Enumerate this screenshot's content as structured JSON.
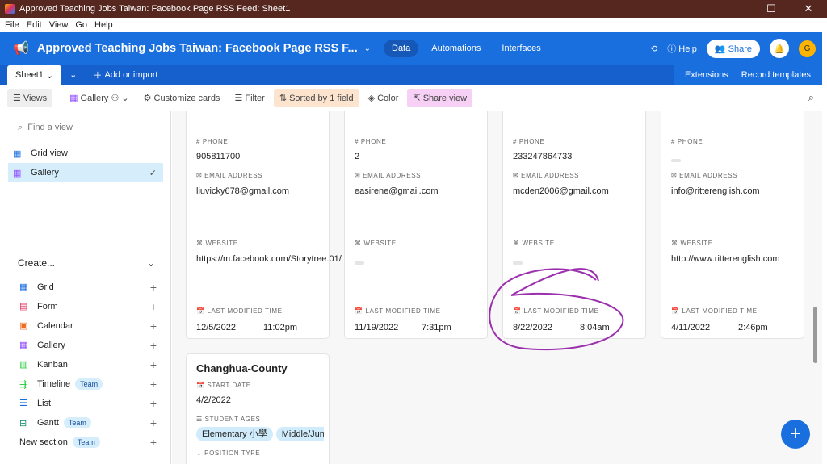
{
  "window": {
    "title": "Approved Teaching Jobs Taiwan: Facebook Page RSS Feed: Sheet1",
    "minimize": "—",
    "maximize": "☐",
    "close": "✕"
  },
  "menu": [
    "File",
    "Edit",
    "View",
    "Go",
    "Help"
  ],
  "header": {
    "base_title": "Approved Teaching Jobs Taiwan: Facebook Page RSS F...",
    "nav": [
      "Data",
      "Automations",
      "Interfaces"
    ],
    "help": "Help",
    "share": "Share",
    "avatar": "G"
  },
  "tabs": {
    "active": "Sheet1",
    "add": "Add or import",
    "extensions": "Extensions",
    "record_templates": "Record templates"
  },
  "toolbar": {
    "views": "Views",
    "gallery": "Gallery",
    "customize": "Customize cards",
    "filter": "Filter",
    "sorted": "Sorted by 1 field",
    "color": "Color",
    "share_view": "Share view"
  },
  "sidebar": {
    "search_placeholder": "Find a view",
    "views": [
      "Grid view",
      "Gallery"
    ],
    "create_label": "Create...",
    "create_items": [
      {
        "label": "Grid"
      },
      {
        "label": "Form"
      },
      {
        "label": "Calendar"
      },
      {
        "label": "Gallery"
      },
      {
        "label": "Kanban"
      },
      {
        "label": "Timeline",
        "badge": "Team"
      },
      {
        "label": "List"
      },
      {
        "label": "Gantt",
        "badge": "Team"
      },
      {
        "label": "New section",
        "badge": "Team"
      }
    ]
  },
  "labels": {
    "phone": "PHONE",
    "email": "EMAIL ADDRESS",
    "website": "WEBSITE",
    "lmt": "LAST MODIFIED TIME",
    "start_date": "START DATE",
    "student_ages": "STUDENT AGES",
    "position_type": "POSITION TYPE"
  },
  "cards": [
    {
      "phone": "905811700",
      "email": "liuvicky678@gmail.com",
      "website": "https://m.facebook.com/Storytree.01/",
      "date": "12/5/2022",
      "time": "11:02pm"
    },
    {
      "phone": "2",
      "email": "easirene@gmail.com",
      "website": "",
      "date": "11/19/2022",
      "time": "7:31pm"
    },
    {
      "phone": "233247864733",
      "email": "mcden2006@gmail.com",
      "website": "",
      "date": "8/22/2022",
      "time": "8:04am"
    },
    {
      "phone": "",
      "email": "info@ritterenglish.com",
      "website": "http://www.ritterenglish.com",
      "date": "4/11/2022",
      "time": "2:46pm"
    }
  ],
  "card2": {
    "title": "Changhua-County",
    "start_date": "4/2/2022",
    "ages": [
      "Elementary 小學",
      "Middle/Junior"
    ]
  },
  "colors": {
    "blue": "#1a6fdf",
    "annotation": "#9b2fae"
  }
}
